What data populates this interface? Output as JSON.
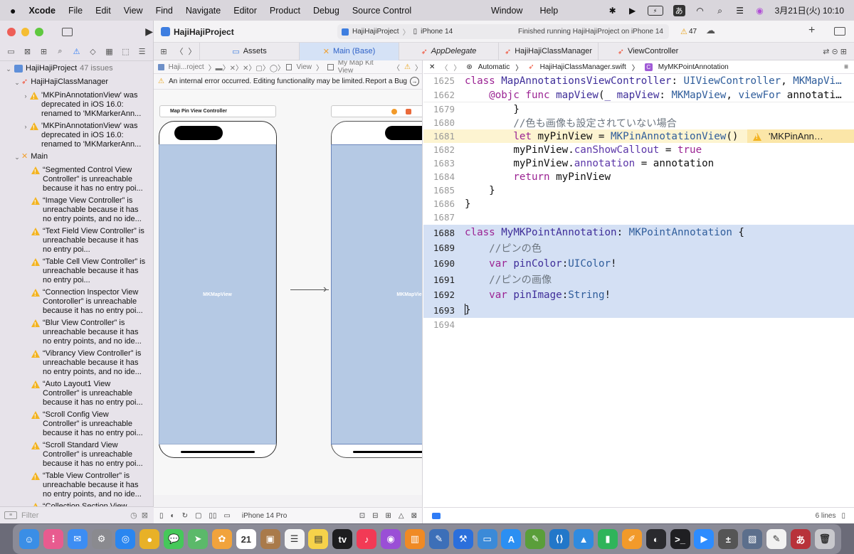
{
  "menubar": {
    "apple": "",
    "app": "Xcode",
    "items": [
      "File",
      "Edit",
      "View",
      "Find",
      "Navigate",
      "Editor",
      "Product",
      "Debug",
      "Source Control"
    ],
    "items2": [
      "Window",
      "Help"
    ],
    "input_method": "あ",
    "date_time": "3月21日(火)  10:10"
  },
  "toolbar": {
    "project": "HajiHajiProject",
    "scheme": "HajiHajiProject",
    "device": "iPhone 14",
    "status": "Finished running HajiHajiProject on iPhone 14",
    "warning_count": "47"
  },
  "sidebar": {
    "project_label": "HajiHajiProject",
    "issue_count": "47 issues",
    "group1": "HajiHajiClassManager",
    "group1_issues": [
      "'MKPinAnnotationView' was deprecated in iOS 16.0: renamed to 'MKMarkerAnn...",
      "'MKPinAnnotationView' was deprecated in iOS 16.0: renamed to 'MKMarkerAnn..."
    ],
    "group2": "Main",
    "group2_issues": [
      "“Segmented Control View Controller” is unreachable because it has no entry poi...",
      "“Image View Controller” is unreachable because it has no entry points, and no ide...",
      "“Text Field View Controller” is unreachable because it has no entry poi...",
      "“Table Cell View Controller” is unreachable because it has no entry poi...",
      "“Connection Inspector View Contoroller” is unreachable because it has no entry poi...",
      "“Blur View Controller” is unreachable because it has no entry points, and no ide...",
      "“Vibrancy View Controller” is unreachable because it has no entry points, and no ide...",
      "“Auto Layout1 View Controller” is unreachable because it has no entry poi...",
      "“Scroll Config View Controller” is unreachable because it has no entry poi...",
      "“Scroll Standard View Controller” is unreachable because it has no entry poi...",
      "“Table View Controller” is unreachable because it has no entry points, and no ide...",
      "“Collection Section View"
    ],
    "filter_placeholder": "Filter"
  },
  "tabs": [
    {
      "label": "Assets",
      "icon": "folder-icon"
    },
    {
      "label": "Main (Base)",
      "icon": "storyboard-icon"
    },
    {
      "label": "AppDelegate",
      "icon": "swift-icon"
    },
    {
      "label": "HajiHajiClassManager",
      "icon": "swift-icon"
    },
    {
      "label": "ViewController",
      "icon": "swift-icon"
    }
  ],
  "storyboard": {
    "jump": [
      "Haji...roject",
      "View",
      "My Map Kit View"
    ],
    "error": "An internal error occurred. Editing functionality may be limited.",
    "report": "Report a Bug",
    "scene_title": "Map Pin View Controller",
    "map_label": "MKMapView",
    "map_label2": "MKMapVie",
    "device": "iPhone 14 Pro"
  },
  "editor": {
    "jump": [
      "Automatic",
      "HajiHajiClassManager.swift",
      "MyMKPointAnnotation"
    ],
    "sticky": [
      {
        "n": "1625",
        "html": "<span class=\"kw\">class</span> <span class=\"tyd\">MapAnnotationsViewController</span>: <span class=\"ty\">UIViewController</span>, <span class=\"ty\">MKMapVi…</span>"
      },
      {
        "n": "1662",
        "html": "    <span class=\"kw\">@objc func</span> <span class=\"tyd\">mapView</span>(<span class=\"tyd\">_</span> <span class=\"tyd\">mapView</span>: <span class=\"ty\">MKMapView</span>, <span class=\"ty\">viewFor</span> annotati…"
      }
    ],
    "lines": [
      {
        "n": "1679",
        "html": "        }"
      },
      {
        "n": "1680",
        "html": "        <span class=\"cm\">//色も画像も設定されていない場合</span>"
      },
      {
        "n": "1681",
        "html": "        <span class=\"kw\">let</span> myPinView = <span class=\"ty\">MKPinAnnotationView</span>()",
        "warn": true
      },
      {
        "n": "1682",
        "html": "        myPinView.<span class=\"pr\">canShowCallout</span> = <span class=\"kw\">true</span>"
      },
      {
        "n": "1683",
        "html": "        myPinView.<span class=\"pr\">annotation</span> = annotation"
      },
      {
        "n": "1684",
        "html": "        <span class=\"kw\">return</span> myPinView"
      },
      {
        "n": "1685",
        "html": "    }"
      },
      {
        "n": "1686",
        "html": "}"
      },
      {
        "n": "1687",
        "html": ""
      },
      {
        "n": "1688",
        "html": "<span class=\"kw\">class</span> <span class=\"tyd\">MyMKPointAnnotation</span>: <span class=\"ty\">MKPointAnnotation</span> {",
        "hl": true
      },
      {
        "n": "1689",
        "html": "    <span class=\"cm\">//ピンの色</span>",
        "hl": true
      },
      {
        "n": "1690",
        "html": "    <span class=\"kw\">var</span> <span class=\"tyd\">pinColor</span>:<span class=\"ty\">UIColor</span>!",
        "hl": true
      },
      {
        "n": "1691",
        "html": "    <span class=\"cm\">//ピンの画像</span>",
        "hl": true
      },
      {
        "n": "1692",
        "html": "    <span class=\"kw\">var</span> <span class=\"tyd\">pinImage</span>:<span class=\"ty\">String</span>!",
        "hl": true
      },
      {
        "n": "1693",
        "html": "}",
        "hl": true
      },
      {
        "n": "1694",
        "html": ""
      }
    ],
    "inline_warning": "'MKPinAnn…",
    "line_count": "6 lines"
  },
  "dock": [
    {
      "name": "finder",
      "bg": "#3a8ee6",
      "glyph": "☺"
    },
    {
      "name": "launchpad",
      "bg": "#e85b8f",
      "glyph": "⋮"
    },
    {
      "name": "mail",
      "bg": "#3c8df3",
      "glyph": "✉"
    },
    {
      "name": "system-settings",
      "bg": "#8a8a8f",
      "glyph": "⚙"
    },
    {
      "name": "safari",
      "bg": "#2a86f0",
      "glyph": "◎"
    },
    {
      "name": "chrome",
      "bg": "#e8b127",
      "glyph": "●"
    },
    {
      "name": "messages",
      "bg": "#45c85a",
      "glyph": "💬"
    },
    {
      "name": "maps",
      "bg": "#5bb96a",
      "glyph": "➤"
    },
    {
      "name": "photos",
      "bg": "#f1a33c",
      "glyph": "✿"
    },
    {
      "name": "calendar",
      "bg": "#ffffff",
      "glyph": "21"
    },
    {
      "name": "notes-brown",
      "bg": "#a97a4a",
      "glyph": "▣"
    },
    {
      "name": "reminders",
      "bg": "#f4f4f4",
      "glyph": "☰"
    },
    {
      "name": "notes",
      "bg": "#f6d24a",
      "glyph": "▤"
    },
    {
      "name": "apple-tv",
      "bg": "#1d1d1f",
      "glyph": "tv"
    },
    {
      "name": "music",
      "bg": "#f23a55",
      "glyph": "♪"
    },
    {
      "name": "podcasts",
      "bg": "#9a4fd6",
      "glyph": "◉"
    },
    {
      "name": "books",
      "bg": "#f08a24",
      "glyph": "▥"
    },
    {
      "name": "xcode-instruments",
      "bg": "#3c6fb8",
      "glyph": "✎"
    },
    {
      "name": "xcode",
      "bg": "#2b6fdc",
      "glyph": "⚒"
    },
    {
      "name": "simulator",
      "bg": "#3b8ad8",
      "glyph": "▭"
    },
    {
      "name": "app-store",
      "bg": "#2b8ff2",
      "glyph": "A"
    },
    {
      "name": "editor-green",
      "bg": "#5a9e3a",
      "glyph": "✎"
    },
    {
      "name": "vscode",
      "bg": "#2277c9",
      "glyph": "⟨⟩"
    },
    {
      "name": "keynote",
      "bg": "#2f8be0",
      "glyph": "▲"
    },
    {
      "name": "numbers",
      "bg": "#2fb45a",
      "glyph": "▮"
    },
    {
      "name": "pages",
      "bg": "#f29a2a",
      "glyph": "✐"
    },
    {
      "name": "github",
      "bg": "#2a2a2e",
      "glyph": "◐"
    },
    {
      "name": "terminal",
      "bg": "#1f1f22",
      "glyph": ">_"
    },
    {
      "name": "zoom",
      "bg": "#2d8cff",
      "glyph": "▶"
    },
    {
      "name": "calculator",
      "bg": "#555",
      "glyph": "±"
    },
    {
      "name": "preview",
      "bg": "#5c6f8c",
      "glyph": "▧"
    },
    {
      "name": "textedit",
      "bg": "#f2f2f2",
      "glyph": "✎"
    },
    {
      "name": "dictionary",
      "bg": "#b8323a",
      "glyph": "あ"
    },
    {
      "name": "trash",
      "bg": "#c8c8cc",
      "glyph": "🗑"
    }
  ]
}
